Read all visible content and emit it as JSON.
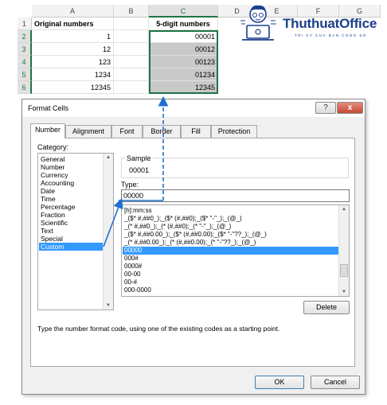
{
  "sheet": {
    "columns": [
      "A",
      "B",
      "C",
      "D",
      "E",
      "F",
      "G"
    ],
    "rows": [
      "1",
      "2",
      "3",
      "4",
      "5",
      "6"
    ],
    "header_row": [
      "Original numbers",
      "",
      "5-digit numbers"
    ],
    "data": [
      [
        "1",
        "00001"
      ],
      [
        "12",
        "00012"
      ],
      [
        "123",
        "00123"
      ],
      [
        "1234",
        "01234"
      ],
      [
        "12345",
        "12345"
      ]
    ]
  },
  "logo": {
    "name": "ThuthuatOffice",
    "tagline": "TRI KY CUA BAN CONG SO"
  },
  "dialog": {
    "title": "Format Cells",
    "help_label": "?",
    "close_label": "x",
    "tabs": [
      "Number",
      "Alignment",
      "Font",
      "Border",
      "Fill",
      "Protection"
    ],
    "category_label": "Category:",
    "categories": [
      "General",
      "Number",
      "Currency",
      "Accounting",
      "Date",
      "Time",
      "Percentage",
      "Fraction",
      "Scientific",
      "Text",
      "Special",
      "Custom"
    ],
    "selected_category": "Custom",
    "sample_label": "Sample",
    "sample_value": "00001",
    "type_label": "Type:",
    "type_value": "00000",
    "formats": [
      "[h]:mm:ss",
      "_($* #,##0_);_($* (#,##0);_($* \"-\"_);_(@_)",
      "_(* #,##0_);_(* (#,##0);_(* \"-\"_);_(@_)",
      "_($* #,##0.00_);_($* (#,##0.00);_($* \"-\"??_);_(@_)",
      "_(* #,##0.00_);_(* (#,##0.00);_(* \"-\"??_);_(@_)",
      "00000",
      "000#",
      "0000#",
      "00-00",
      "00-#",
      "000-0000"
    ],
    "selected_format": "00000",
    "delete_label": "Delete",
    "description": "Type the number format code, using one of the existing codes as a starting point.",
    "ok_label": "OK",
    "cancel_label": "Cancel"
  },
  "colors": {
    "accent": "#217346",
    "selection": "#3399ff",
    "arrow": "#1f6fd0",
    "brand": "#1b3f8b"
  }
}
